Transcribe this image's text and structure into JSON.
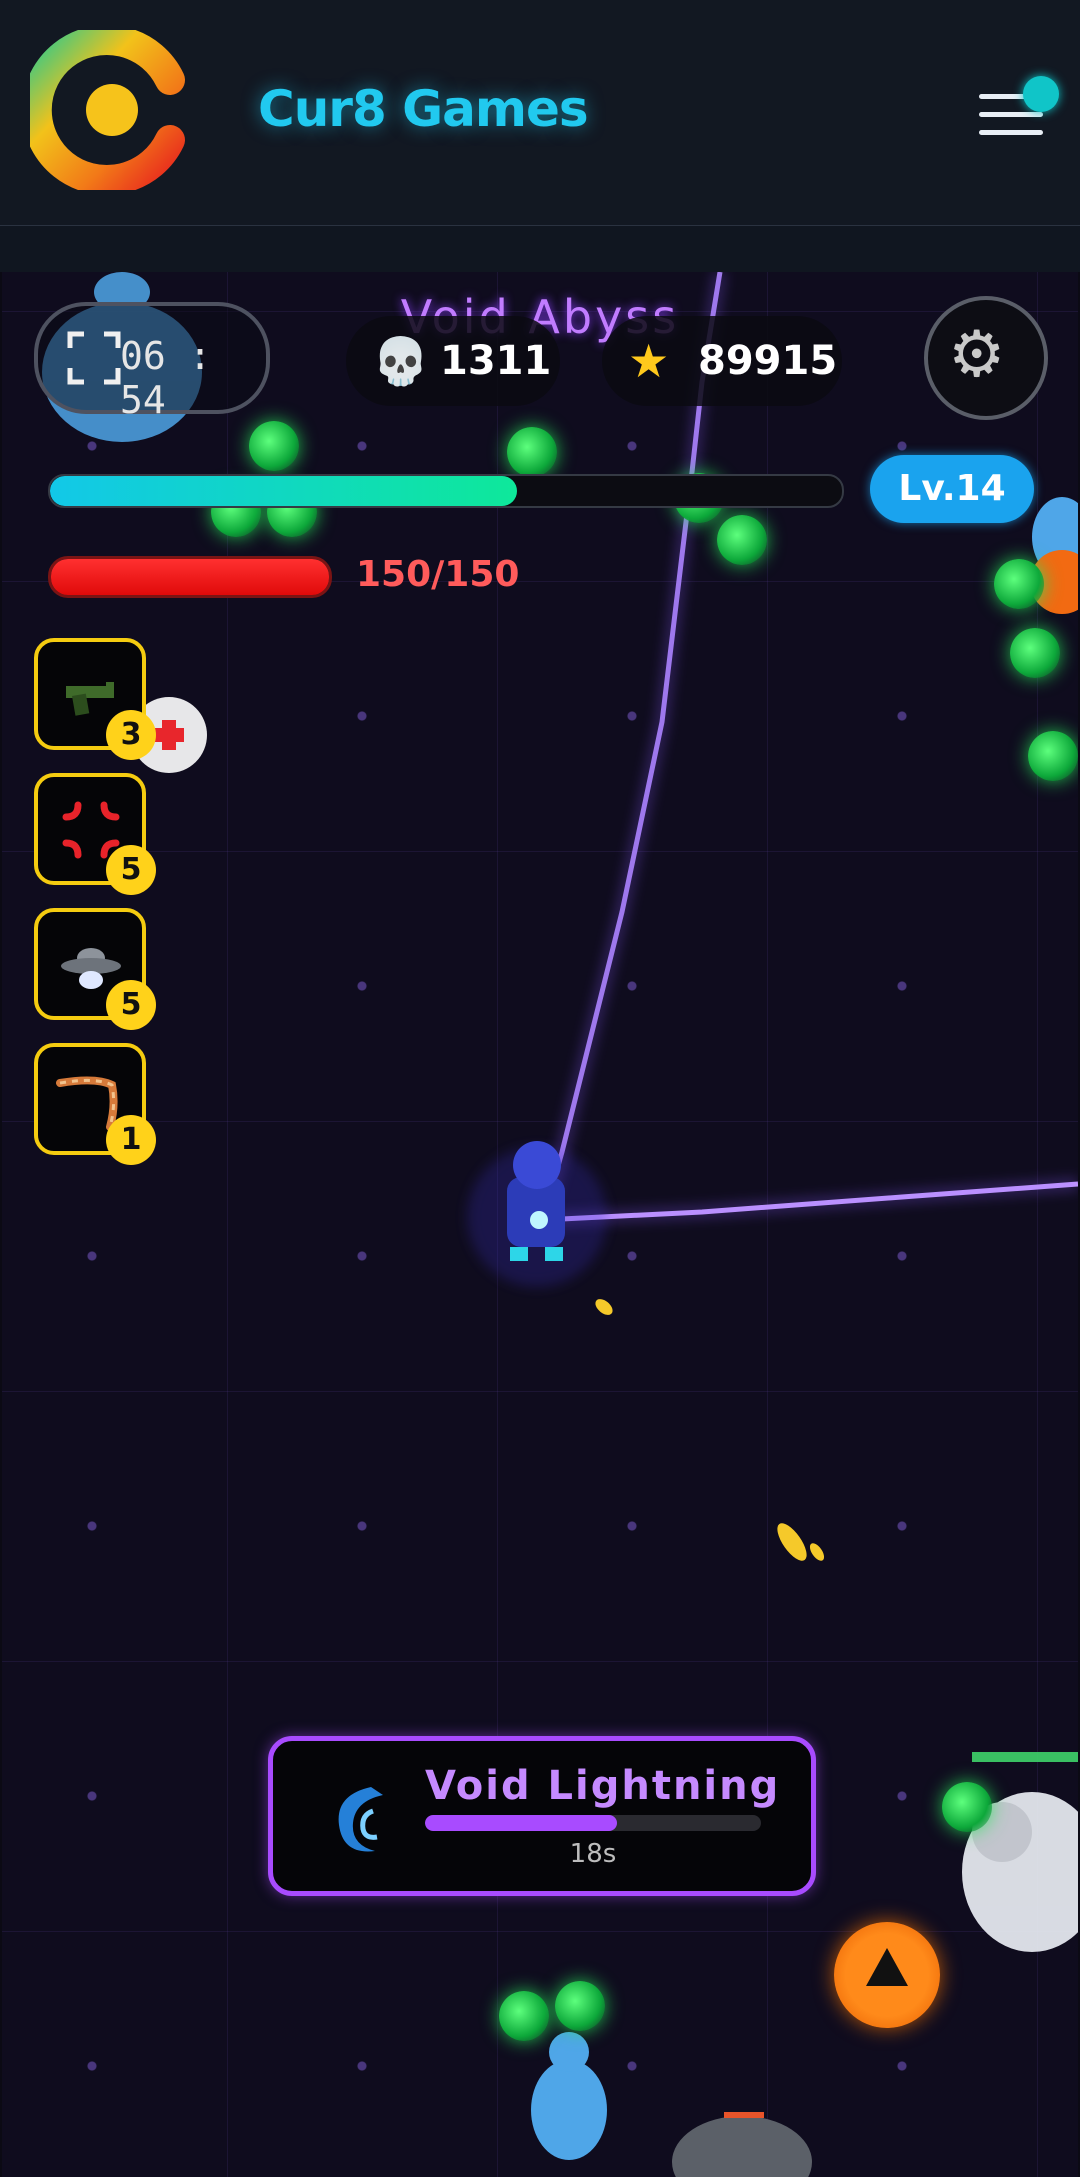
{
  "header": {
    "brand": "Cur8 Games",
    "logo_icon": "cur8-logo-icon",
    "menu_icon": "hamburger-menu-icon"
  },
  "hud": {
    "zone_name": "Void Abyss",
    "timer": "06:54",
    "timer_icon": "fullscreen-icon",
    "kills": "1311",
    "kills_icon": "skull-icon",
    "score": "89915",
    "score_icon": "star-icon",
    "settings_icon": "gear-icon",
    "level": "Lv.14",
    "xp_fraction": 0.59,
    "hp_text": "150/150",
    "hp_fraction": 1.0
  },
  "weapons": [
    {
      "icon": "pistol-icon",
      "level": "3"
    },
    {
      "icon": "anger-burst-icon",
      "level": "5"
    },
    {
      "icon": "ufo-icon",
      "level": "5"
    },
    {
      "icon": "boomerang-icon",
      "level": "1"
    }
  ],
  "active_skill": {
    "name": "Void Lightning",
    "icon": "cyclone-icon",
    "time_left": "18s",
    "progress_fraction": 0.57
  },
  "colors": {
    "brand": "#21c9ef",
    "zone_title": "#c17cff",
    "xp_start": "#12c8e8",
    "xp_end": "#0ee89a",
    "level_badge": "#1aa3ee",
    "hp": "#ff2020",
    "skill_accent": "#a84bff",
    "slot_border": "#f5cc10"
  }
}
